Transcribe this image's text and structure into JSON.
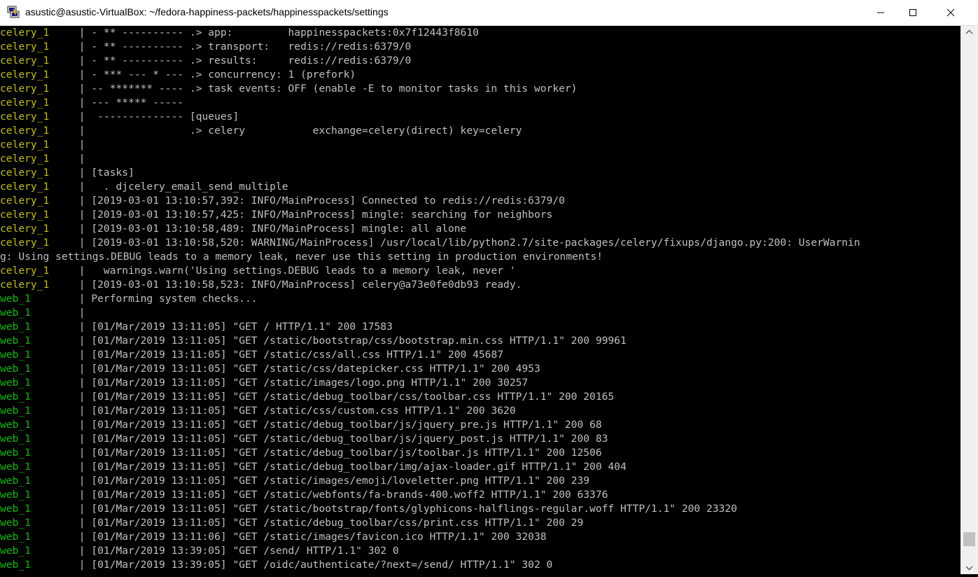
{
  "window": {
    "title": "asustic@asustic-VirtualBox: ~/fedora-happiness-packets/happinesspackets/settings",
    "icon": "putty-terminal-icon",
    "controls": [
      "minimize-icon",
      "maximize-icon",
      "close-icon"
    ]
  },
  "colors": {
    "background": "#000000",
    "text": "#c0c0c0",
    "celery": "#c0c000",
    "web": "#00c000"
  },
  "scrollbar": {
    "position": 0.97
  },
  "lines": [
    {
      "svc": "celery_1",
      "sep": " | ",
      "msg": "- ** ---------- .> app:         happinesspackets:0x7f12443f8610"
    },
    {
      "svc": "celery_1",
      "sep": " | ",
      "msg": "- ** ---------- .> transport:   redis://redis:6379/0"
    },
    {
      "svc": "celery_1",
      "sep": " | ",
      "msg": "- ** ---------- .> results:     redis://redis:6379/0"
    },
    {
      "svc": "celery_1",
      "sep": " | ",
      "msg": "- *** --- * --- .> concurrency: 1 (prefork)"
    },
    {
      "svc": "celery_1",
      "sep": " | ",
      "msg": "-- ******* ---- .> task events: OFF (enable -E to monitor tasks in this worker)"
    },
    {
      "svc": "celery_1",
      "sep": " | ",
      "msg": "--- ***** -----"
    },
    {
      "svc": "celery_1",
      "sep": " | ",
      "msg": " -------------- [queues]"
    },
    {
      "svc": "celery_1",
      "sep": " | ",
      "msg": "                .> celery           exchange=celery(direct) key=celery"
    },
    {
      "svc": "celery_1",
      "sep": " | ",
      "msg": ""
    },
    {
      "svc": "celery_1",
      "sep": " | ",
      "msg": ""
    },
    {
      "svc": "celery_1",
      "sep": " | ",
      "msg": "[tasks]"
    },
    {
      "svc": "celery_1",
      "sep": " | ",
      "msg": "  . djcelery_email_send_multiple"
    },
    {
      "svc": "celery_1",
      "sep": " | ",
      "msg": "[2019-03-01 13:10:57,392: INFO/MainProcess] Connected to redis://redis:6379/0"
    },
    {
      "svc": "celery_1",
      "sep": " | ",
      "msg": "[2019-03-01 13:10:57,425: INFO/MainProcess] mingle: searching for neighbors"
    },
    {
      "svc": "celery_1",
      "sep": " | ",
      "msg": "[2019-03-01 13:10:58,489: INFO/MainProcess] mingle: all alone"
    },
    {
      "svc": "celery_1",
      "sep": " | ",
      "msg": "[2019-03-01 13:10:58,520: WARNING/MainProcess] /usr/local/lib/python2.7/site-packages/celery/fixups/django.py:200: UserWarnin"
    },
    {
      "svc": "",
      "sep": "",
      "msg": "g: Using settings.DEBUG leads to a memory leak, never use this setting in production environments!"
    },
    {
      "svc": "celery_1",
      "sep": " | ",
      "msg": "  warnings.warn('Using settings.DEBUG leads to a memory leak, never '"
    },
    {
      "svc": "celery_1",
      "sep": " | ",
      "msg": "[2019-03-01 13:10:58,523: INFO/MainProcess] celery@a73e0fe0db93 ready."
    },
    {
      "svc": "web_1",
      "sep": " | ",
      "msg": "Performing system checks..."
    },
    {
      "svc": "web_1",
      "sep": " | ",
      "msg": ""
    },
    {
      "svc": "web_1",
      "sep": " | ",
      "msg": "[01/Mar/2019 13:11:05] \"GET / HTTP/1.1\" 200 17583"
    },
    {
      "svc": "web_1",
      "sep": " | ",
      "msg": "[01/Mar/2019 13:11:05] \"GET /static/bootstrap/css/bootstrap.min.css HTTP/1.1\" 200 99961"
    },
    {
      "svc": "web_1",
      "sep": " | ",
      "msg": "[01/Mar/2019 13:11:05] \"GET /static/css/all.css HTTP/1.1\" 200 45687"
    },
    {
      "svc": "web_1",
      "sep": " | ",
      "msg": "[01/Mar/2019 13:11:05] \"GET /static/css/datepicker.css HTTP/1.1\" 200 4953"
    },
    {
      "svc": "web_1",
      "sep": " | ",
      "msg": "[01/Mar/2019 13:11:05] \"GET /static/images/logo.png HTTP/1.1\" 200 30257"
    },
    {
      "svc": "web_1",
      "sep": " | ",
      "msg": "[01/Mar/2019 13:11:05] \"GET /static/debug_toolbar/css/toolbar.css HTTP/1.1\" 200 20165"
    },
    {
      "svc": "web_1",
      "sep": " | ",
      "msg": "[01/Mar/2019 13:11:05] \"GET /static/css/custom.css HTTP/1.1\" 200 3620"
    },
    {
      "svc": "web_1",
      "sep": " | ",
      "msg": "[01/Mar/2019 13:11:05] \"GET /static/debug_toolbar/js/jquery_pre.js HTTP/1.1\" 200 68"
    },
    {
      "svc": "web_1",
      "sep": " | ",
      "msg": "[01/Mar/2019 13:11:05] \"GET /static/debug_toolbar/js/jquery_post.js HTTP/1.1\" 200 83"
    },
    {
      "svc": "web_1",
      "sep": " | ",
      "msg": "[01/Mar/2019 13:11:05] \"GET /static/debug_toolbar/js/toolbar.js HTTP/1.1\" 200 12506"
    },
    {
      "svc": "web_1",
      "sep": " | ",
      "msg": "[01/Mar/2019 13:11:05] \"GET /static/debug_toolbar/img/ajax-loader.gif HTTP/1.1\" 200 404"
    },
    {
      "svc": "web_1",
      "sep": " | ",
      "msg": "[01/Mar/2019 13:11:05] \"GET /static/images/emoji/loveletter.png HTTP/1.1\" 200 239"
    },
    {
      "svc": "web_1",
      "sep": " | ",
      "msg": "[01/Mar/2019 13:11:05] \"GET /static/webfonts/fa-brands-400.woff2 HTTP/1.1\" 200 63376"
    },
    {
      "svc": "web_1",
      "sep": " | ",
      "msg": "[01/Mar/2019 13:11:05] \"GET /static/bootstrap/fonts/glyphicons-halflings-regular.woff HTTP/1.1\" 200 23320"
    },
    {
      "svc": "web_1",
      "sep": " | ",
      "msg": "[01/Mar/2019 13:11:05] \"GET /static/debug_toolbar/css/print.css HTTP/1.1\" 200 29"
    },
    {
      "svc": "web_1",
      "sep": " | ",
      "msg": "[01/Mar/2019 13:11:06] \"GET /static/images/favicon.ico HTTP/1.1\" 200 32038"
    },
    {
      "svc": "web_1",
      "sep": " | ",
      "msg": "[01/Mar/2019 13:39:05] \"GET /send/ HTTP/1.1\" 302 0"
    },
    {
      "svc": "web_1",
      "sep": " | ",
      "msg": "[01/Mar/2019 13:39:05] \"GET /oidc/authenticate/?next=/send/ HTTP/1.1\" 302 0"
    }
  ]
}
